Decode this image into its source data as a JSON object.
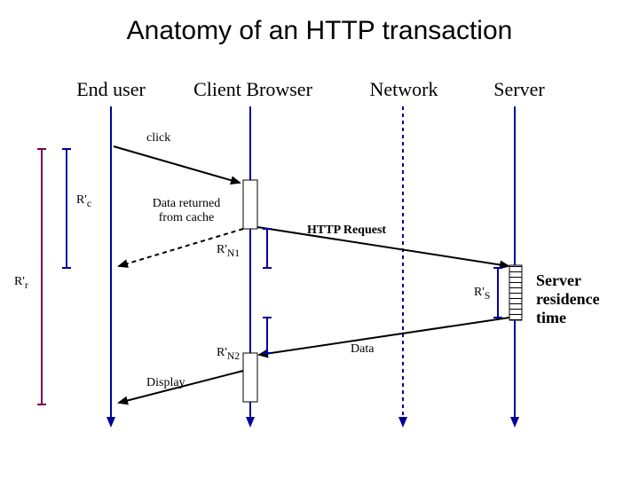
{
  "title": "Anatomy of an HTTP transaction",
  "lifelines": {
    "end_user": "End user",
    "client_browser": "Client Browser",
    "network": "Network",
    "server": "Server"
  },
  "messages": {
    "click": "click",
    "data_cache_l1": "Data returned",
    "data_cache_l2": "from cache",
    "http_request": "HTTP Request",
    "data": "Data",
    "display": "Display"
  },
  "spans": {
    "rc": "R'",
    "rc_sub": "c",
    "rr": "R'",
    "rr_sub": "r",
    "rn1": "R'",
    "rn1_sub": "N1",
    "rs": "R'",
    "rs_sub": "S",
    "rn2": "R'",
    "rn2_sub": "N2"
  },
  "annotation": {
    "l1": "Server",
    "l2": "residence",
    "l3": "time"
  },
  "colors": {
    "blue": "#000099"
  }
}
